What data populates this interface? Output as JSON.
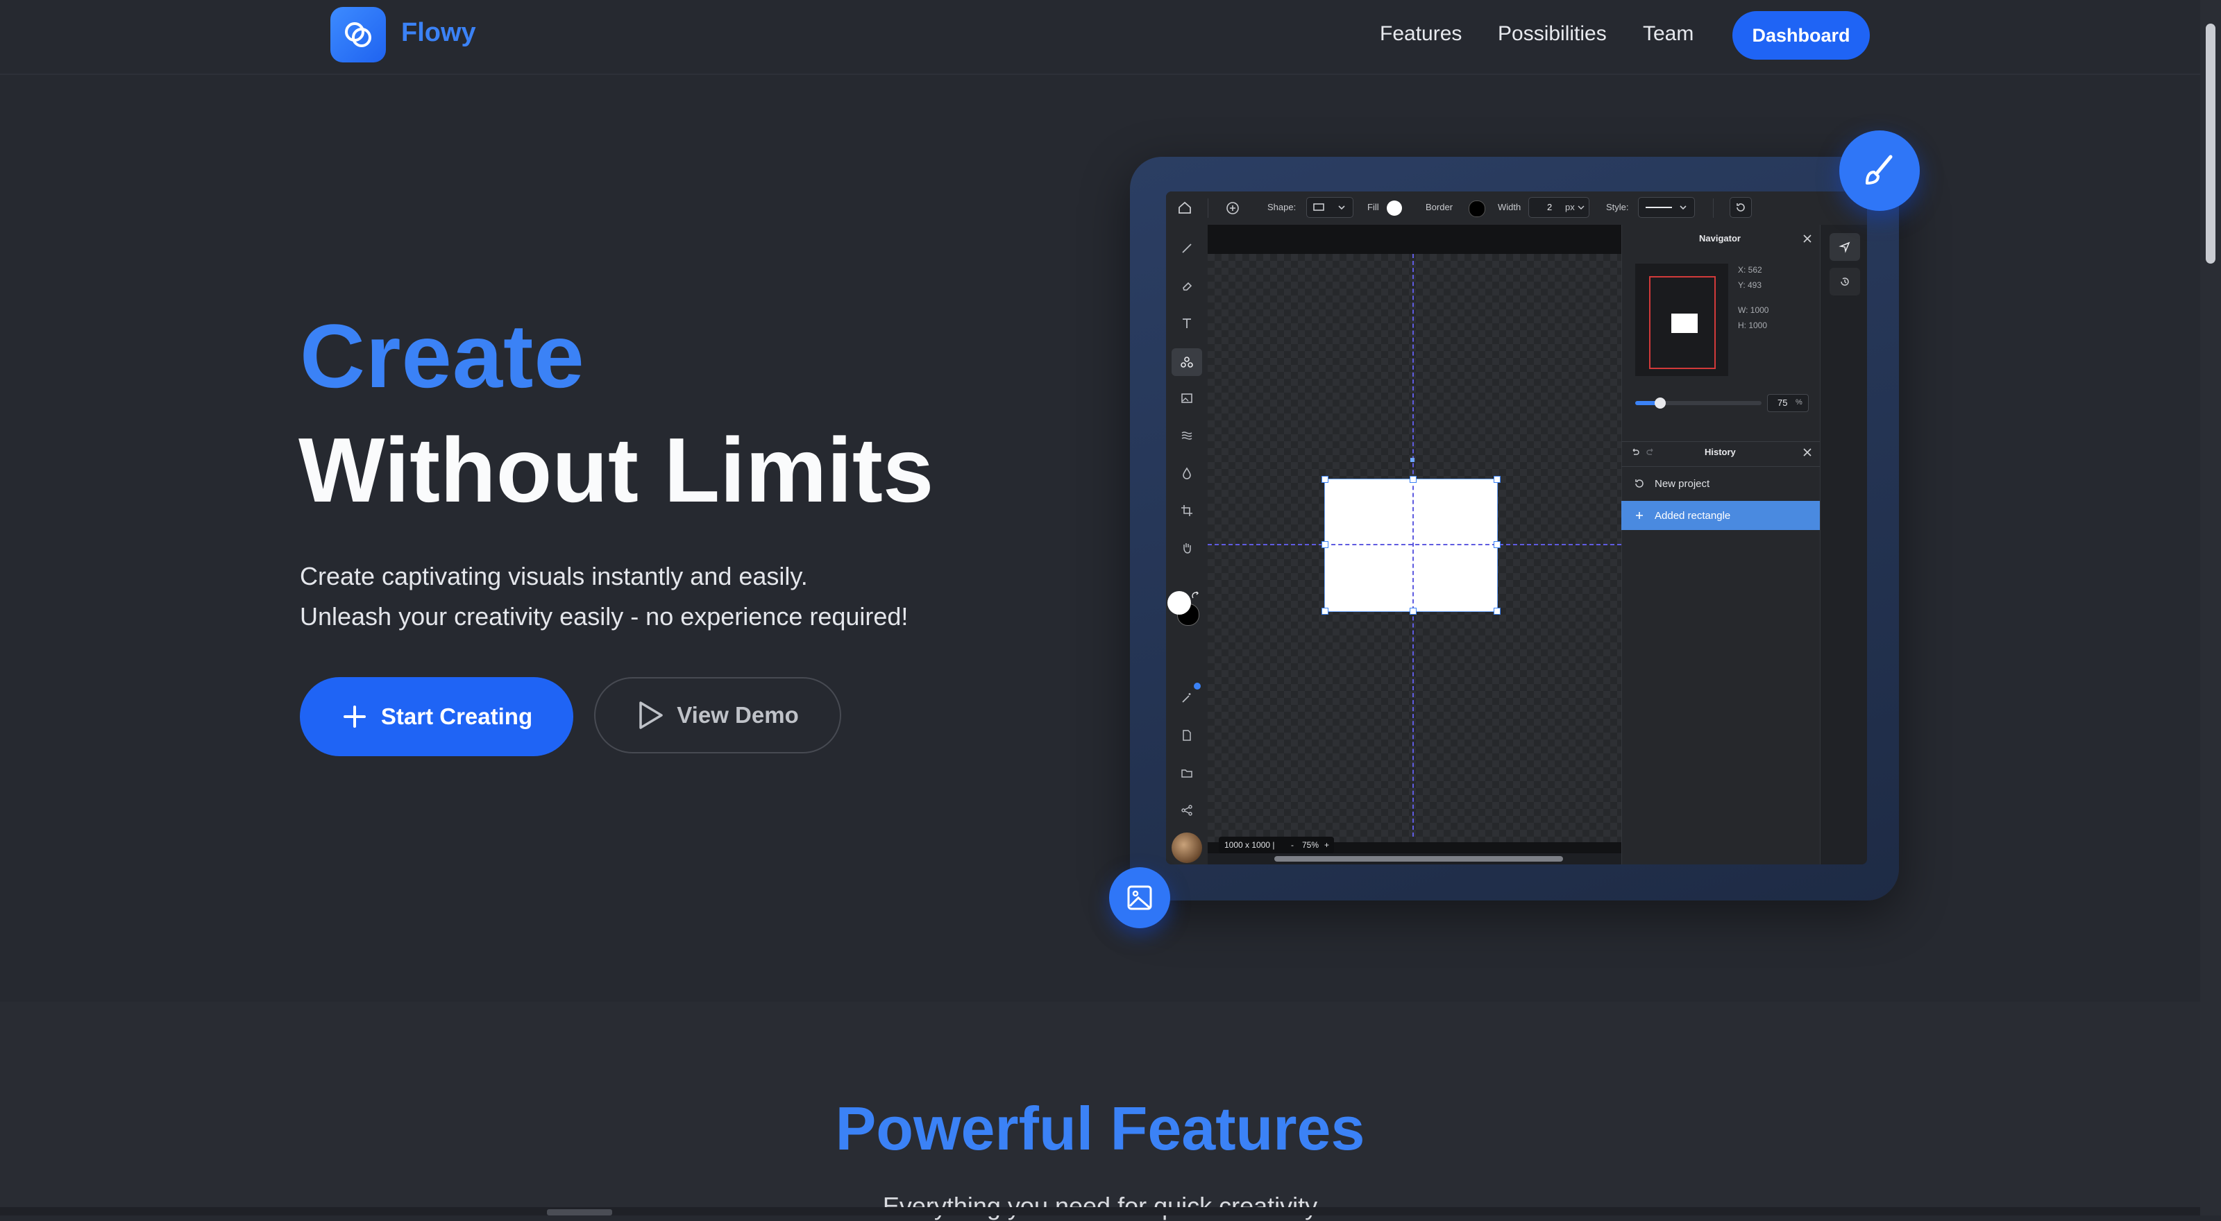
{
  "nav": {
    "brand": "Flowy",
    "links": [
      "Features",
      "Possibilities",
      "Team"
    ],
    "dashboard": "Dashboard"
  },
  "hero": {
    "title_1": "Create",
    "title_2": "Without Limits",
    "sub_1": "Create captivating visuals instantly and easily.",
    "sub_2": "Unleash your creativity easily - no experience required!",
    "start_btn": "Start Creating",
    "demo_btn": "View Demo"
  },
  "editor": {
    "toolbar": {
      "shape_label": "Shape:",
      "fill_label": "Fill",
      "border_label": "Border",
      "width_label": "Width",
      "width_value": "2",
      "width_unit": "px",
      "style_label": "Style:"
    },
    "navigator": {
      "title": "Navigator",
      "x": "X:   562",
      "y": "Y:   493",
      "w": "W:  1000",
      "h": "H:  1000",
      "zoom": "75",
      "zoom_unit": "%",
      "zoom_fraction": 0.2
    },
    "history": {
      "title": "History",
      "items": [
        "New project",
        "Added rectangle"
      ]
    },
    "status": {
      "size": "1000 x 1000 |",
      "minus": "-",
      "zoom": "75%",
      "plus": "+"
    }
  },
  "features": {
    "title": "Powerful Features",
    "subtitle": "Everything you need for quick creativity"
  },
  "colors": {
    "accent": "#1f64f5",
    "brand_text": "#3b82f6",
    "background": "#262930"
  }
}
